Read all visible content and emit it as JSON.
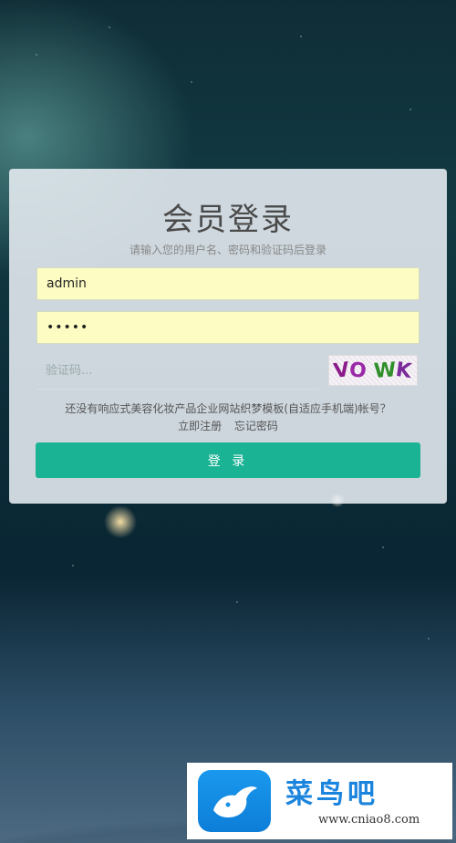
{
  "login": {
    "title": "会员登录",
    "subtitle": "请输入您的用户名、密码和验证码后登录",
    "username_value": "admin",
    "password_value": "•••••",
    "captcha_placeholder": "验证码...",
    "captcha_chars": [
      {
        "char": "V",
        "color": "#8b1a8b"
      },
      {
        "char": "O",
        "color": "#9a2aa8"
      },
      {
        "char": "W",
        "color": "#2f8f2a"
      },
      {
        "char": "K",
        "color": "#7a2a9a"
      }
    ],
    "note": "还没有响应式美容化妆产品企业网站织梦模板(自适应手机端)帐号？",
    "register_link": "立即注册",
    "forgot_link": "忘记密码",
    "submit_label": "登 录",
    "accent_color": "#1ab394"
  },
  "watermark": {
    "brand": "菜鸟吧",
    "url": "www.cniao8.com",
    "logo_icon": "bird-icon"
  }
}
